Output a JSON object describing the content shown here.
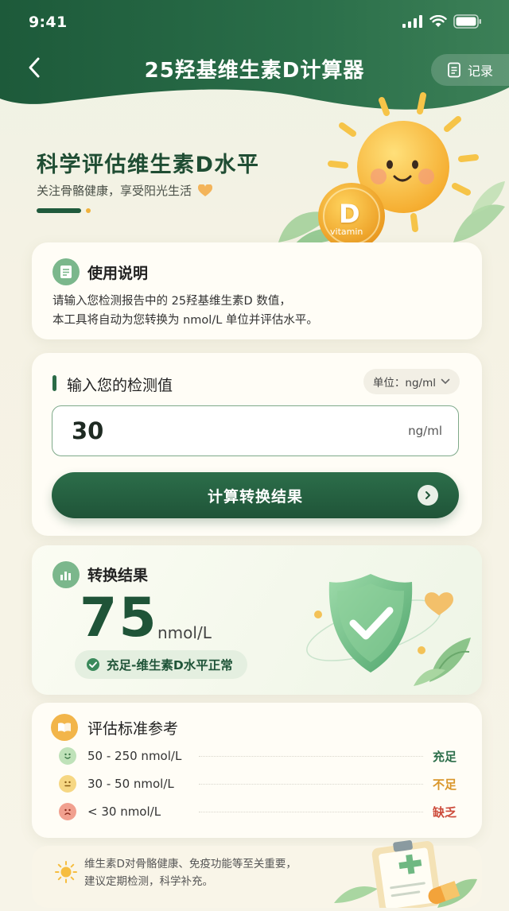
{
  "status_bar": {
    "time": "9:41"
  },
  "nav": {
    "title": "25羟基维生素D计算器",
    "record_label": "记录"
  },
  "hero": {
    "title": "科学评估维生素D水平",
    "subtitle": "关注骨骼健康，享受阳光生活",
    "badge_letter": "D",
    "badge_text": "vitamin"
  },
  "instructions": {
    "title": "使用说明",
    "line1": "请输入您检测报告中的 25羟基维生素D 数值，",
    "line2": "本工具将自动为您转换为 nmol/L 单位并评估水平。"
  },
  "input_card": {
    "title": "输入您的检测值",
    "unit_select": "单位：ng/ml",
    "value": "30",
    "unit": "ng/ml",
    "button_label": "计算转换结果"
  },
  "result": {
    "title": "转换结果",
    "value": "75",
    "unit": "nmol/L",
    "status": "充足-维生素D水平正常"
  },
  "reference": {
    "title": "评估标准参考",
    "rows": [
      {
        "range": "50 - 250 nmol/L",
        "level": "充足",
        "color": "#2c6e4a"
      },
      {
        "range": "30 - 50 nmol/L",
        "level": "不足",
        "color": "#d9962b"
      },
      {
        "range": "< 30  nmol/L",
        "level": "缺乏",
        "color": "#cc4a3a"
      }
    ]
  },
  "tip": {
    "line1": "维生素D对骨骼健康、免疫功能等至关重要，",
    "line2": "建议定期检测，科学补充。"
  },
  "colors": {
    "primary": "#1f5438",
    "accent": "#f2b54a"
  }
}
